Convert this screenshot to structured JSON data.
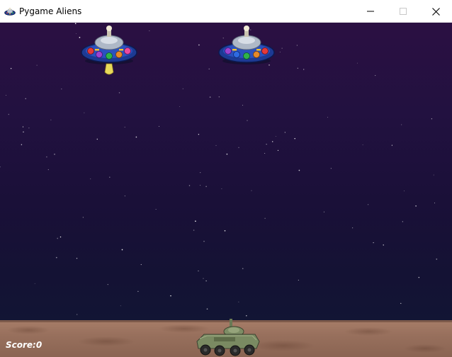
{
  "window": {
    "title": "Pygame Aliens",
    "icon": "pygame-alien-icon",
    "controls": {
      "minimize_icon": "minimize-icon",
      "maximize_icon": "maximize-icon",
      "close_icon": "close-icon"
    }
  },
  "hud": {
    "score_label": "Score:",
    "score_value": "0"
  },
  "scene": {
    "aliens": [
      {
        "id": "alien-1",
        "icon": "ufo-icon",
        "has_bomb": true
      },
      {
        "id": "alien-2",
        "icon": "ufo-icon",
        "has_bomb": false
      }
    ],
    "player": {
      "icon": "tank-icon"
    }
  },
  "colors": {
    "sky_top": "#2b1042",
    "sky_bottom": "#121534",
    "ground": "#98705d",
    "hud_text": "#ffffff"
  }
}
